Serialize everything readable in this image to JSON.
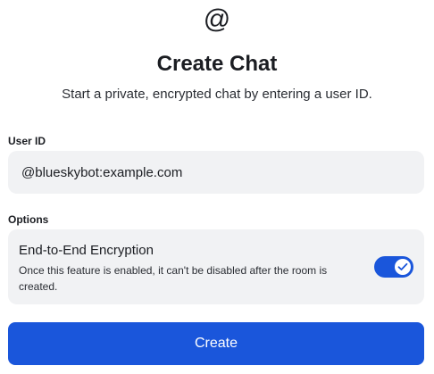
{
  "header": {
    "icon": "at-sign-icon",
    "icon_glyph": "@",
    "title": "Create Chat",
    "subtitle": "Start a private, encrypted chat by entering a user ID."
  },
  "user_id": {
    "label": "User ID",
    "value": "@blueskybot:example.com"
  },
  "options": {
    "label": "Options",
    "encryption": {
      "title": "End-to-End Encryption",
      "description": "Once this feature is enabled, it can't be disabled after the room is created.",
      "enabled": true,
      "toggle_icon": "checkmark-icon"
    }
  },
  "actions": {
    "create_label": "Create"
  },
  "colors": {
    "accent": "#1a56db",
    "field_background": "#f1f2f4",
    "text": "#1b1d22"
  }
}
